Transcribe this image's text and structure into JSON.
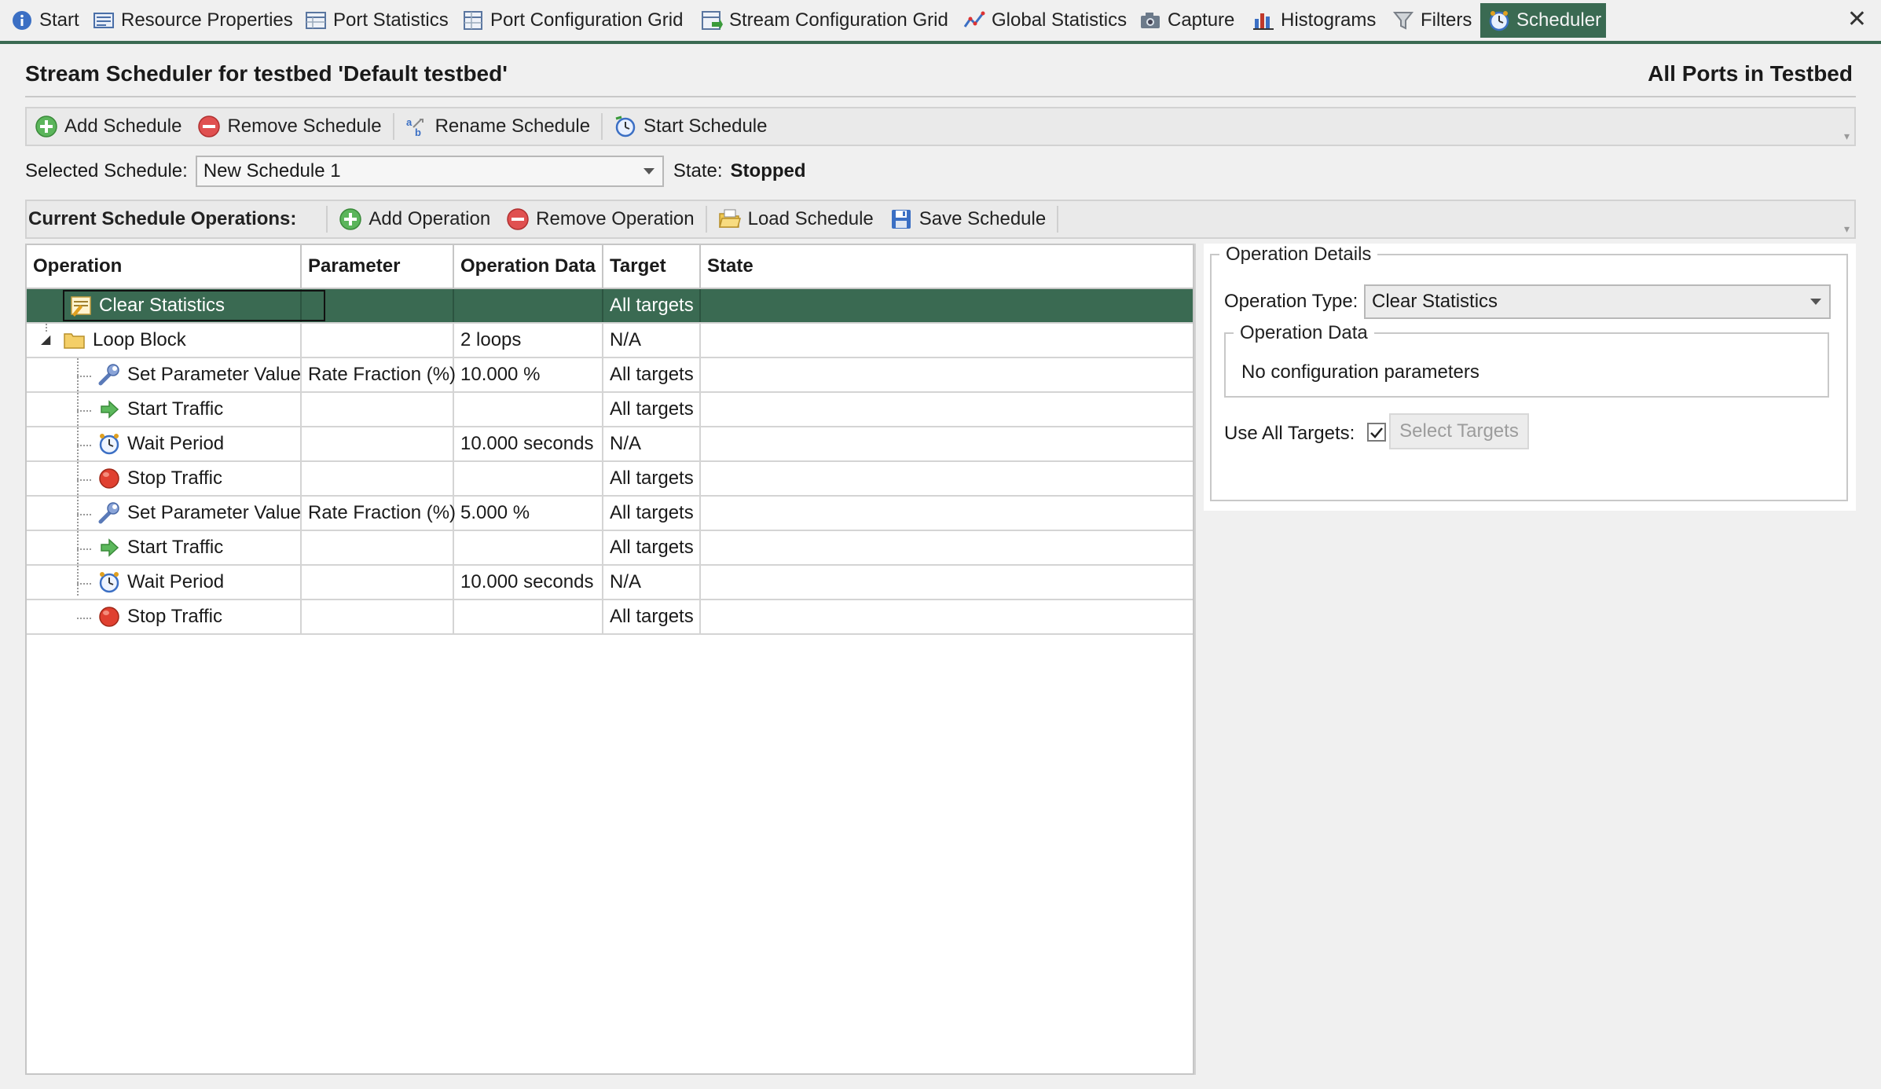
{
  "tabs": [
    {
      "label": "Start",
      "icon": "info-icon"
    },
    {
      "label": "Resource Properties",
      "icon": "properties-icon"
    },
    {
      "label": "Port Statistics",
      "icon": "port-stats-icon"
    },
    {
      "label": "Port Configuration Grid",
      "icon": "port-config-icon"
    },
    {
      "label": "Stream Configuration Grid",
      "icon": "stream-config-icon"
    },
    {
      "label": "Global Statistics",
      "icon": "line-chart-icon"
    },
    {
      "label": "Capture",
      "icon": "camera-icon"
    },
    {
      "label": "Histograms",
      "icon": "histogram-icon"
    },
    {
      "label": "Filters",
      "icon": "filter-icon"
    },
    {
      "label": "Scheduler",
      "icon": "scheduler-clock-icon",
      "active": true
    }
  ],
  "close_label": "✕",
  "header": {
    "title": "Stream Scheduler for testbed 'Default testbed'",
    "scope": "All Ports in Testbed"
  },
  "schedule_toolbar": {
    "add": "Add Schedule",
    "remove": "Remove Schedule",
    "rename": "Rename Schedule",
    "start": "Start Schedule"
  },
  "selection": {
    "label": "Selected Schedule:",
    "value": "New Schedule 1",
    "state_label": "State:",
    "state_value": "Stopped"
  },
  "ops_toolbar": {
    "title": "Current Schedule Operations:",
    "add": "Add Operation",
    "remove": "Remove Operation",
    "load": "Load Schedule",
    "save": "Save Schedule"
  },
  "table": {
    "columns": [
      "Operation",
      "Parameter",
      "Operation Data",
      "Target",
      "State"
    ],
    "rows": [
      {
        "operation": "Clear Statistics",
        "parameter": "",
        "data": "",
        "target": "All targets",
        "state": "",
        "icon": "clear-stats-icon",
        "level": 0,
        "selected": true
      },
      {
        "operation": "Loop Block",
        "parameter": "",
        "data": "2 loops",
        "target": "N/A",
        "state": "",
        "icon": "folder-icon",
        "level": 0,
        "expanded": true
      },
      {
        "operation": "Set Parameter Value",
        "parameter": "Rate Fraction (%)",
        "data": "10.000 %",
        "target": "All targets",
        "state": "",
        "icon": "wrench-icon",
        "level": 1
      },
      {
        "operation": "Start Traffic",
        "parameter": "",
        "data": "",
        "target": "All targets",
        "state": "",
        "icon": "green-arrow-icon",
        "level": 1
      },
      {
        "operation": "Wait Period",
        "parameter": "",
        "data": "10.000 seconds",
        "target": "N/A",
        "state": "",
        "icon": "alarm-clock-icon",
        "level": 1
      },
      {
        "operation": "Stop Traffic",
        "parameter": "",
        "data": "",
        "target": "All targets",
        "state": "",
        "icon": "red-stop-icon",
        "level": 1
      },
      {
        "operation": "Set Parameter Value",
        "parameter": "Rate Fraction (%)",
        "data": "5.000 %",
        "target": "All targets",
        "state": "",
        "icon": "wrench-icon",
        "level": 1
      },
      {
        "operation": "Start Traffic",
        "parameter": "",
        "data": "",
        "target": "All targets",
        "state": "",
        "icon": "green-arrow-icon",
        "level": 1
      },
      {
        "operation": "Wait Period",
        "parameter": "",
        "data": "10.000 seconds",
        "target": "N/A",
        "state": "",
        "icon": "alarm-clock-icon",
        "level": 1
      },
      {
        "operation": "Stop Traffic",
        "parameter": "",
        "data": "",
        "target": "All targets",
        "state": "",
        "icon": "red-stop-icon",
        "level": 1
      }
    ]
  },
  "details": {
    "group_title": "Operation Details",
    "type_label": "Operation Type:",
    "type_value": "Clear Statistics",
    "data_group_title": "Operation Data",
    "data_text": "No configuration parameters",
    "use_all_label": "Use All Targets:",
    "use_all_checked": true,
    "select_targets": "Select Targets"
  },
  "colors": {
    "accent": "#3a6a52",
    "selected_row": "#3a6a52"
  }
}
